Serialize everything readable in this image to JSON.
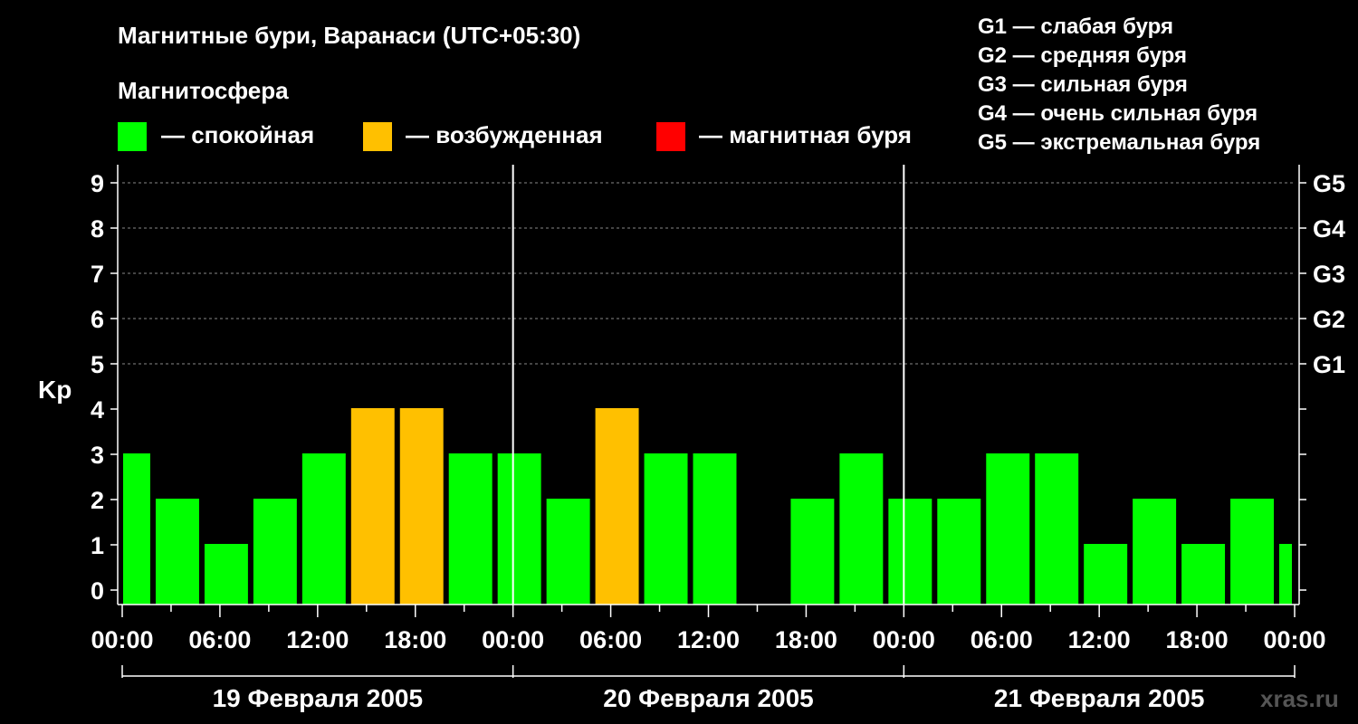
{
  "title": "Магнитные бури, Варанаси (UTC+05:30)",
  "legend": {
    "heading": "Магнитосфера",
    "items": [
      {
        "label": "— спокойная",
        "color": "#00ff00"
      },
      {
        "label": "— возбужденная",
        "color": "#ffc000"
      },
      {
        "label": "— магнитная буря",
        "color": "#ff0000"
      }
    ]
  },
  "storm_scale": [
    "G1 — слабая буря",
    "G2 — средняя буря",
    "G3 — сильная буря",
    "G4 — очень сильная буря",
    "G5 — экстремальная буря"
  ],
  "watermark": "xras.ru",
  "chart_data": {
    "type": "bar",
    "ylabel": "Kp",
    "ylim": [
      0,
      9
    ],
    "y_ticks": [
      "0",
      "1",
      "2",
      "3",
      "4",
      "5",
      "6",
      "7",
      "8",
      "9"
    ],
    "right_ticks": [
      {
        "kp": 5,
        "label": "G1"
      },
      {
        "kp": 6,
        "label": "G2"
      },
      {
        "kp": 7,
        "label": "G3"
      },
      {
        "kp": 8,
        "label": "G4"
      },
      {
        "kp": 9,
        "label": "G5"
      }
    ],
    "grid": true,
    "x_tick_labels": [
      "00:00",
      "06:00",
      "12:00",
      "18:00",
      "00:00",
      "06:00",
      "12:00",
      "18:00",
      "00:00",
      "06:00",
      "12:00",
      "18:00",
      "00:00"
    ],
    "days": [
      "19 Февраля 2005",
      "20 Февраля 2005",
      "21 Февраля 2005"
    ],
    "colors": {
      "quiet": "#00ff00",
      "active": "#ffc000",
      "storm": "#ff0000"
    },
    "bars": [
      {
        "start_hour": -1.0,
        "kp": 3
      },
      {
        "start_hour": 2.0,
        "kp": 2
      },
      {
        "start_hour": 5.0,
        "kp": 1
      },
      {
        "start_hour": 8.0,
        "kp": 2
      },
      {
        "start_hour": 11.0,
        "kp": 3
      },
      {
        "start_hour": 14.0,
        "kp": 4
      },
      {
        "start_hour": 17.0,
        "kp": 4
      },
      {
        "start_hour": 20.0,
        "kp": 3
      },
      {
        "start_hour": 23.0,
        "kp": 3
      },
      {
        "start_hour": 26.0,
        "kp": 2
      },
      {
        "start_hour": 29.0,
        "kp": 4
      },
      {
        "start_hour": 32.0,
        "kp": 3
      },
      {
        "start_hour": 35.0,
        "kp": 3
      },
      {
        "start_hour": 38.0,
        "kp": 0
      },
      {
        "start_hour": 41.0,
        "kp": 2
      },
      {
        "start_hour": 44.0,
        "kp": 3
      },
      {
        "start_hour": 47.0,
        "kp": 2
      },
      {
        "start_hour": 50.0,
        "kp": 2
      },
      {
        "start_hour": 53.0,
        "kp": 3
      },
      {
        "start_hour": 56.0,
        "kp": 3
      },
      {
        "start_hour": 59.0,
        "kp": 1
      },
      {
        "start_hour": 62.0,
        "kp": 2
      },
      {
        "start_hour": 65.0,
        "kp": 1
      },
      {
        "start_hour": 68.0,
        "kp": 2
      },
      {
        "start_hour": 71.0,
        "kp": 1
      }
    ]
  }
}
